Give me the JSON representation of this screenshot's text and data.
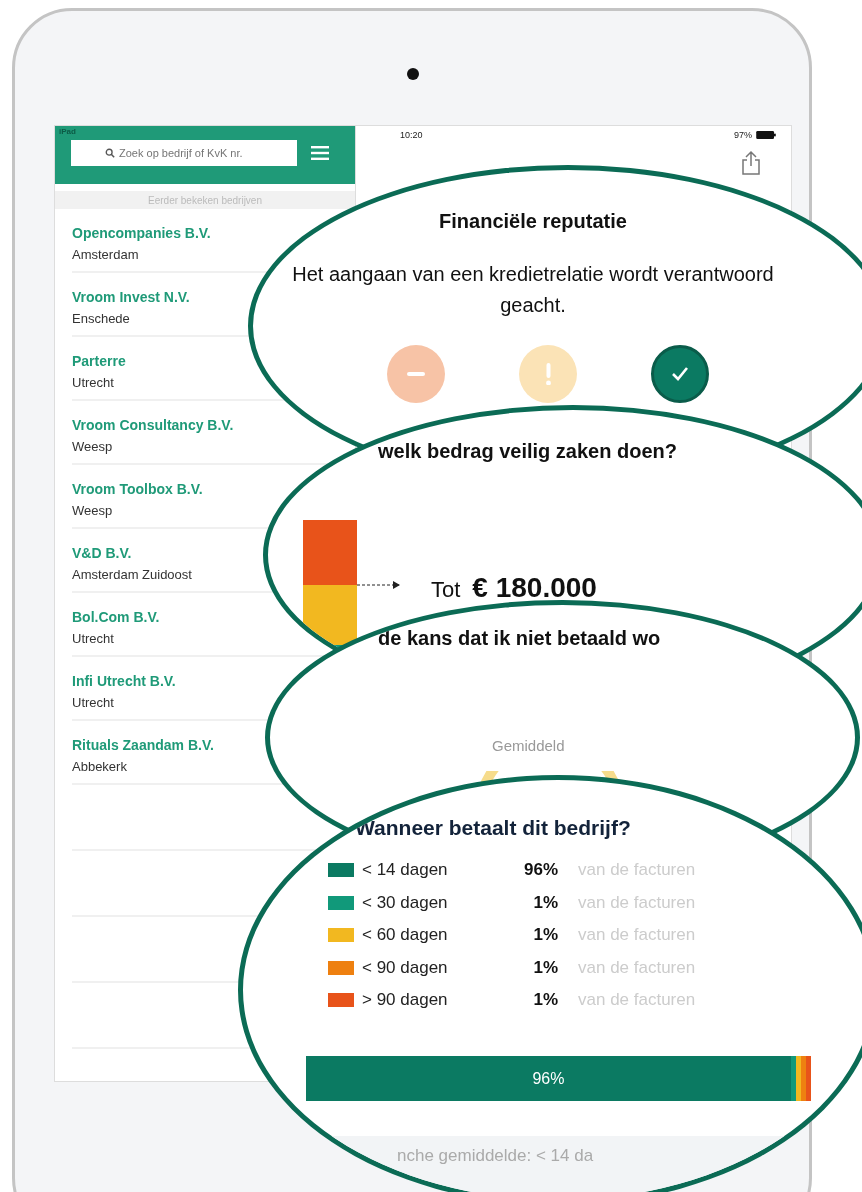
{
  "status_bar": {
    "carrier": "iPad",
    "time": "10:20",
    "battery": "97%"
  },
  "sidebar": {
    "search": {
      "placeholder": "Zoek op bedrijf of KvK nr."
    },
    "section_title": "Eerder bekeken bedrijven",
    "companies": [
      {
        "name": "Opencompanies B.V.",
        "city": "Amsterdam"
      },
      {
        "name": "Vroom Invest N.V.",
        "city": "Enschede"
      },
      {
        "name": "Parterre",
        "city": "Utrecht"
      },
      {
        "name": "Vroom Consultancy B.V.",
        "city": "Weesp"
      },
      {
        "name": "Vroom Toolbox B.V.",
        "city": "Weesp"
      },
      {
        "name": "V&D B.V.",
        "city": "Amsterdam Zuidoost"
      },
      {
        "name": "Bol.Com B.V.",
        "city": "Utrecht"
      },
      {
        "name": "Infi Utrecht B.V.",
        "city": "Utrecht"
      },
      {
        "name": "Rituals Zaandam B.V.",
        "city": "Abbekerk"
      }
    ]
  },
  "reputation": {
    "title": "Financiële reputatie",
    "message": "Het aangaan van een kredietrelatie wordt verantwoord geacht.",
    "levels": [
      {
        "kind": "negative",
        "selected": false
      },
      {
        "kind": "warning",
        "selected": false
      },
      {
        "kind": "positive",
        "selected": true
      }
    ]
  },
  "credit": {
    "question": "welk bedrag veilig zaken doen?",
    "prefix": "Tot",
    "amount": "€ 180.000"
  },
  "risk": {
    "question": "de kans dat ik niet betaald wo",
    "label": "Gemiddeld"
  },
  "payment": {
    "title": "Wanneer betaalt dit bedrijf?",
    "rows": [
      {
        "label": "< 14 dagen",
        "percent": "96%",
        "suffix": "van de facturen",
        "color": "#0b7a62"
      },
      {
        "label": "< 30 dagen",
        "percent": "1%",
        "suffix": "van de facturen",
        "color": "#11997a"
      },
      {
        "label": "< 60 dagen",
        "percent": "1%",
        "suffix": "van de facturen",
        "color": "#f2b820"
      },
      {
        "label": "< 90 dagen",
        "percent": "1%",
        "suffix": "van de facturen",
        "color": "#ee8010"
      },
      {
        "label": "> 90 dagen",
        "percent": "1%",
        "suffix": "van de facturen",
        "color": "#e8531a"
      }
    ],
    "bar": {
      "level": 0.96,
      "label": "96%"
    },
    "footer": "nche gemiddelde: < 14 da"
  }
}
